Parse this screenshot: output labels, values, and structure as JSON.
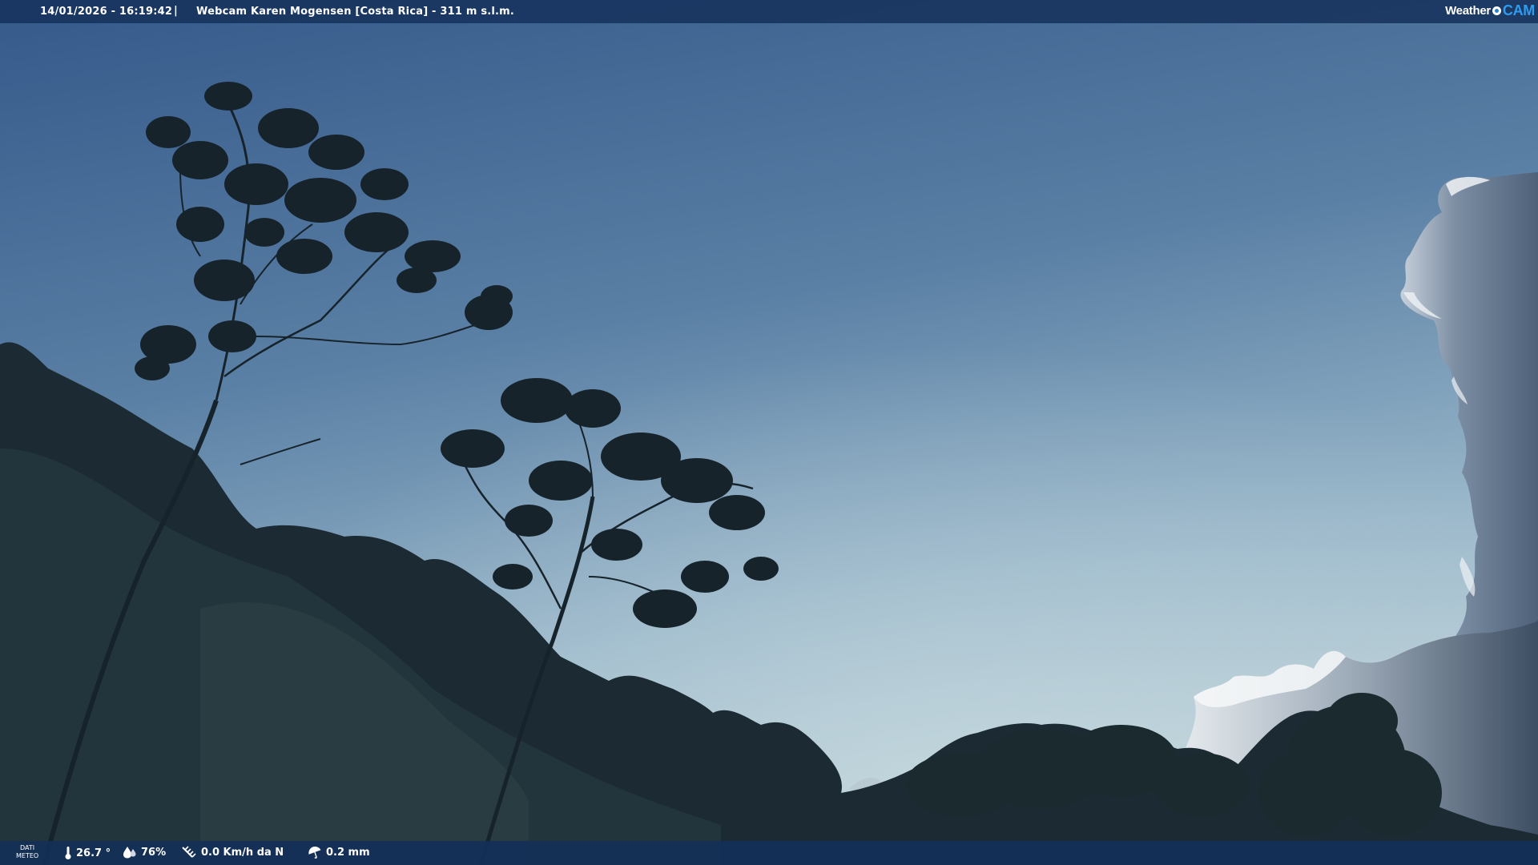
{
  "overlay": {
    "datetime": "14/01/2026 - 16:19:42",
    "separator": "|",
    "title": "Webcam Karen Mogensen [Costa Rica]  - 311 m s.l.m.",
    "brand_weather": "Weather",
    "brand_cam": "CAM"
  },
  "footer": {
    "label_line1": "DATI",
    "label_line2": "METEO",
    "temperature": "26.7 °",
    "humidity": "76%",
    "wind": "0.0 Km/h da N",
    "rain": "0.2 mm"
  },
  "colors": {
    "sky_top": "#3a5f8c",
    "sky_horizon": "#a9c2cf",
    "bar": "#16325c",
    "brand_cam": "#2f9cf0"
  }
}
